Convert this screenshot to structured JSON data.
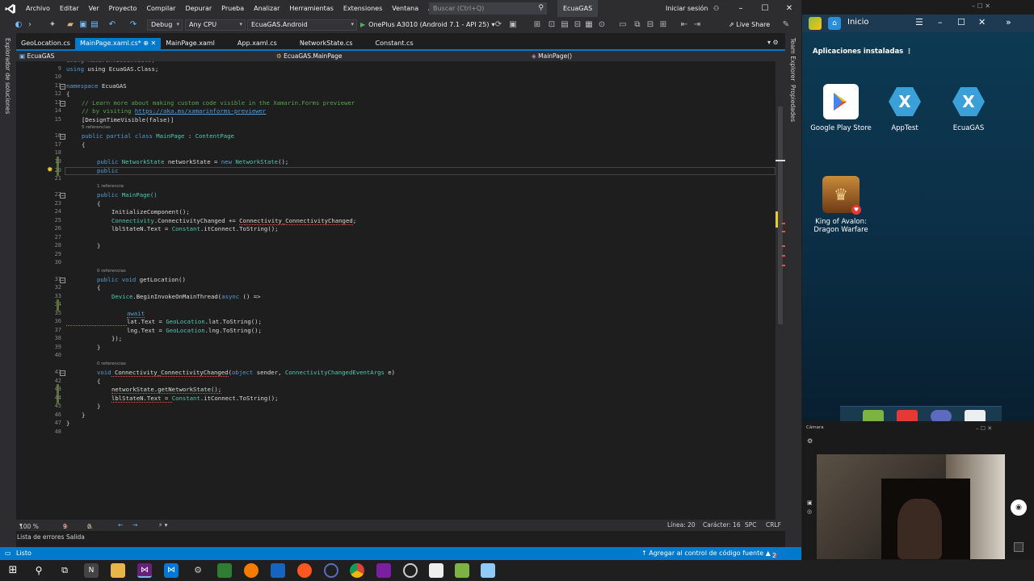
{
  "menu": {
    "items": [
      "Archivo",
      "Editar",
      "Ver",
      "Proyecto",
      "Compilar",
      "Depurar",
      "Prueba",
      "Analizar",
      "Herramientas",
      "Extensiones",
      "Ventana",
      "Ayuda"
    ],
    "search_placeholder": "Buscar (Ctrl+Q)",
    "solution_title": "EcuaGAS",
    "signin": "Iniciar sesión"
  },
  "toolbar": {
    "config": "Debug",
    "platform": "Any CPU",
    "project": "EcuaGAS.Android",
    "run_target": "OnePlus A3010 (Android 7.1 - API 25)",
    "liveshare": "Live Share"
  },
  "side": {
    "left_panel": "Explorador de soluciones",
    "right_panel_1": "Team Explorer",
    "right_panel_2": "Propiedades"
  },
  "tabs": [
    {
      "label": "GeoLocation.cs",
      "active": false
    },
    {
      "label": "MainPage.xaml.cs*  ⊕ ✕",
      "active": true
    },
    {
      "label": "MainPage.xaml",
      "active": false
    },
    {
      "label": "App.xaml.cs",
      "active": false
    },
    {
      "label": "NetworkState.cs",
      "active": false
    },
    {
      "label": "Constant.cs",
      "active": false
    }
  ],
  "navbar": {
    "project": "EcuaGAS",
    "class": "EcuaGAS.MainPage",
    "member": "MainPage()"
  },
  "code": {
    "l9": "using EcuaGAS.Class;",
    "l11_kw": "namespace",
    "l11_name": " EcuaGAS",
    "l12": "{",
    "l13": "// Learn more about making custom code visible in the Xamarin.Forms previewer",
    "l14_pre": "// by visiting ",
    "l14_link": "https://aka.ms/xamarinforms-previewer",
    "l15": "[DesignTimeVisible(false)]",
    "l16_lens": "5 referencias",
    "l16_kw": "public partial class",
    "l16_name": " MainPage",
    "l16_sep": " : ",
    "l16_base": "ContentPage",
    "l17": "{",
    "l19_kw": "public",
    "l19_ty": " NetworkState",
    "l19_mid": " networkState = ",
    "l19_new": "new",
    "l19_ty2": " NetworkState",
    "l19_end": "();",
    "l20": "public",
    "l22_lens": "1 referencia",
    "l22_kw": "public",
    "l22_name": " MainPage()",
    "l23": "{",
    "l24": "InitializeComponent();",
    "l25_a": "Connectivity",
    "l25_b": ".ConnectivityChanged += ",
    "l25_c": "Connectivity_ConnectivityChanged",
    "l25_d": ";",
    "l26_a": "lblStateN.Text = ",
    "l26_b": "Constant",
    "l26_c": ".itConnect.ToString();",
    "l28": "}",
    "l31_lens": "0 referencias",
    "l31_kw": "public void",
    "l31_name": " getLocation()",
    "l32": "{",
    "l33_a": "Device",
    "l33_b": ".BeginInvokeOnMainThread(",
    "l33_c": "async",
    "l33_d": " () =>",
    "l35": "await",
    "l36_a": "lat.Text = ",
    "l36_b": "GeoLocation",
    "l36_c": ".lat.ToString();",
    "l37_a": "lng.Text = ",
    "l37_b": "GeoLocation",
    "l37_c": ".lng.ToString();",
    "l38": "});",
    "l39": "}",
    "l41_lens": "0 referencias",
    "l41_kw": "void",
    "l41_name": " Connectivity_ConnectivityChanged",
    "l41_p1": "(",
    "l41_obj": "object",
    "l41_mid": " sender, ",
    "l41_ty": "ConnectivityChangedEventArgs",
    "l41_end": " e)",
    "l42": "{",
    "l43": "networkState.getNetworkState();",
    "l44_a": "lblStateN.Text = ",
    "l44_b": "Constant",
    "l44_c": ".itConnect.ToString();",
    "l45": "}",
    "l46": "}",
    "l47": "}"
  },
  "editor_bottom": {
    "zoom": "100 %",
    "errors": "9",
    "warnings": "0",
    "line": "Línea: 20",
    "char": "Carácter: 16",
    "spc": "SPC",
    "crlf": "CRLF"
  },
  "panels": {
    "errors": "Lista de errores",
    "output": "Salida"
  },
  "status": {
    "left": "Listo",
    "right": "↑ Agregar al control de código fuente ▲",
    "badge": "2"
  },
  "emulator": {
    "home": "Inicio",
    "installed": "Aplicaciones instaladas",
    "apps": [
      "Google Play Store",
      "AppTest",
      "EcuaGAS"
    ],
    "game": "King of Avalon: Dragon Warfare"
  },
  "camera": {
    "title": "Cámara"
  },
  "colors": {
    "accent": "#007acc",
    "keyword": "#569cd6",
    "type": "#4ec9b0",
    "comment": "#57a64a"
  }
}
